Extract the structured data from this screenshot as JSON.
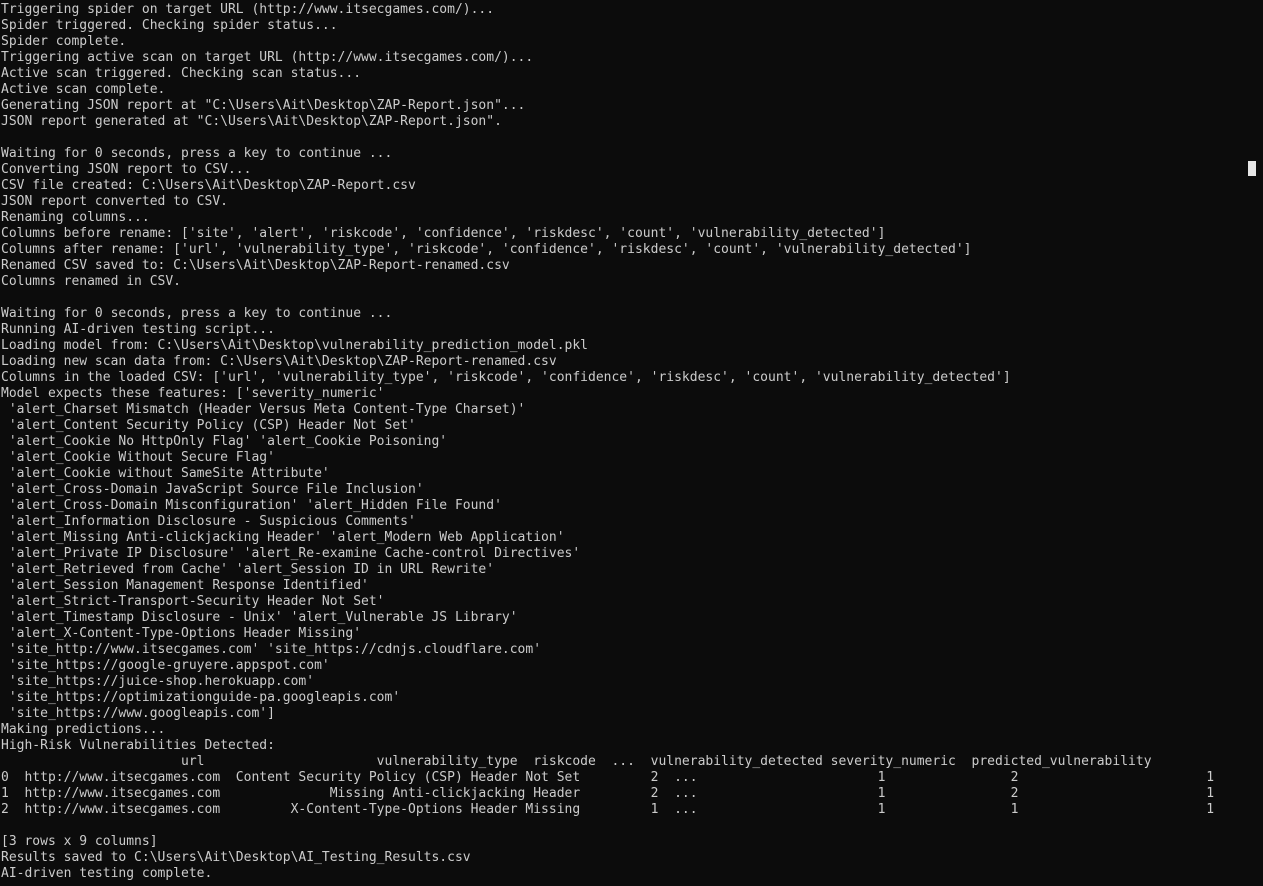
{
  "colors": {
    "background": "#0c0c0c",
    "foreground": "#cccccc",
    "cursor": "#e6e6e6"
  },
  "console": {
    "lines": [
      "Triggering spider on target URL (http://www.itsecgames.com/)...",
      "Spider triggered. Checking spider status...",
      "Spider complete.",
      "Triggering active scan on target URL (http://www.itsecgames.com/)...",
      "Active scan triggered. Checking scan status...",
      "Active scan complete.",
      "Generating JSON report at \"C:\\Users\\Ait\\Desktop\\ZAP-Report.json\"...",
      "JSON report generated at \"C:\\Users\\Ait\\Desktop\\ZAP-Report.json\".",
      "",
      "Waiting for 0 seconds, press a key to continue ...",
      "Converting JSON report to CSV...",
      "CSV file created: C:\\Users\\Ait\\Desktop\\ZAP-Report.csv",
      "JSON report converted to CSV.",
      "Renaming columns...",
      "Columns before rename: ['site', 'alert', 'riskcode', 'confidence', 'riskdesc', 'count', 'vulnerability_detected']",
      "Columns after rename: ['url', 'vulnerability_type', 'riskcode', 'confidence', 'riskdesc', 'count', 'vulnerability_detected']",
      "Renamed CSV saved to: C:\\Users\\Ait\\Desktop\\ZAP-Report-renamed.csv",
      "Columns renamed in CSV.",
      "",
      "Waiting for 0 seconds, press a key to continue ...",
      "Running AI-driven testing script...",
      "Loading model from: C:\\Users\\Ait\\Desktop\\vulnerability_prediction_model.pkl",
      "Loading new scan data from: C:\\Users\\Ait\\Desktop\\ZAP-Report-renamed.csv",
      "Columns in the loaded CSV: ['url', 'vulnerability_type', 'riskcode', 'confidence', 'riskdesc', 'count', 'vulnerability_detected']",
      "Model expects these features: ['severity_numeric'",
      " 'alert_Charset Mismatch (Header Versus Meta Content-Type Charset)'",
      " 'alert_Content Security Policy (CSP) Header Not Set'",
      " 'alert_Cookie No HttpOnly Flag' 'alert_Cookie Poisoning'",
      " 'alert_Cookie Without Secure Flag'",
      " 'alert_Cookie without SameSite Attribute'",
      " 'alert_Cross-Domain JavaScript Source File Inclusion'",
      " 'alert_Cross-Domain Misconfiguration' 'alert_Hidden File Found'",
      " 'alert_Information Disclosure - Suspicious Comments'",
      " 'alert_Missing Anti-clickjacking Header' 'alert_Modern Web Application'",
      " 'alert_Private IP Disclosure' 'alert_Re-examine Cache-control Directives'",
      " 'alert_Retrieved from Cache' 'alert_Session ID in URL Rewrite'",
      " 'alert_Session Management Response Identified'",
      " 'alert_Strict-Transport-Security Header Not Set'",
      " 'alert_Timestamp Disclosure - Unix' 'alert_Vulnerable JS Library'",
      " 'alert_X-Content-Type-Options Header Missing'",
      " 'site_http://www.itsecgames.com' 'site_https://cdnjs.cloudflare.com'",
      " 'site_https://google-gruyere.appspot.com'",
      " 'site_https://juice-shop.herokuapp.com'",
      " 'site_https://optimizationguide-pa.googleapis.com'",
      " 'site_https://www.googleapis.com']",
      "Making predictions...",
      "High-Risk Vulnerabilities Detected:",
      "                       url                      vulnerability_type  riskcode  ...  vulnerability_detected severity_numeric  predicted_vulnerability",
      "0  http://www.itsecgames.com  Content Security Policy (CSP) Header Not Set         2  ...                       1                2                        1",
      "1  http://www.itsecgames.com              Missing Anti-clickjacking Header         2  ...                       1                2                        1",
      "2  http://www.itsecgames.com         X-Content-Type-Options Header Missing         1  ...                       1                1                        1",
      "",
      "[3 rows x 9 columns]",
      "Results saved to C:\\Users\\Ait\\Desktop\\AI_Testing_Results.csv",
      "AI-driven testing complete."
    ]
  }
}
